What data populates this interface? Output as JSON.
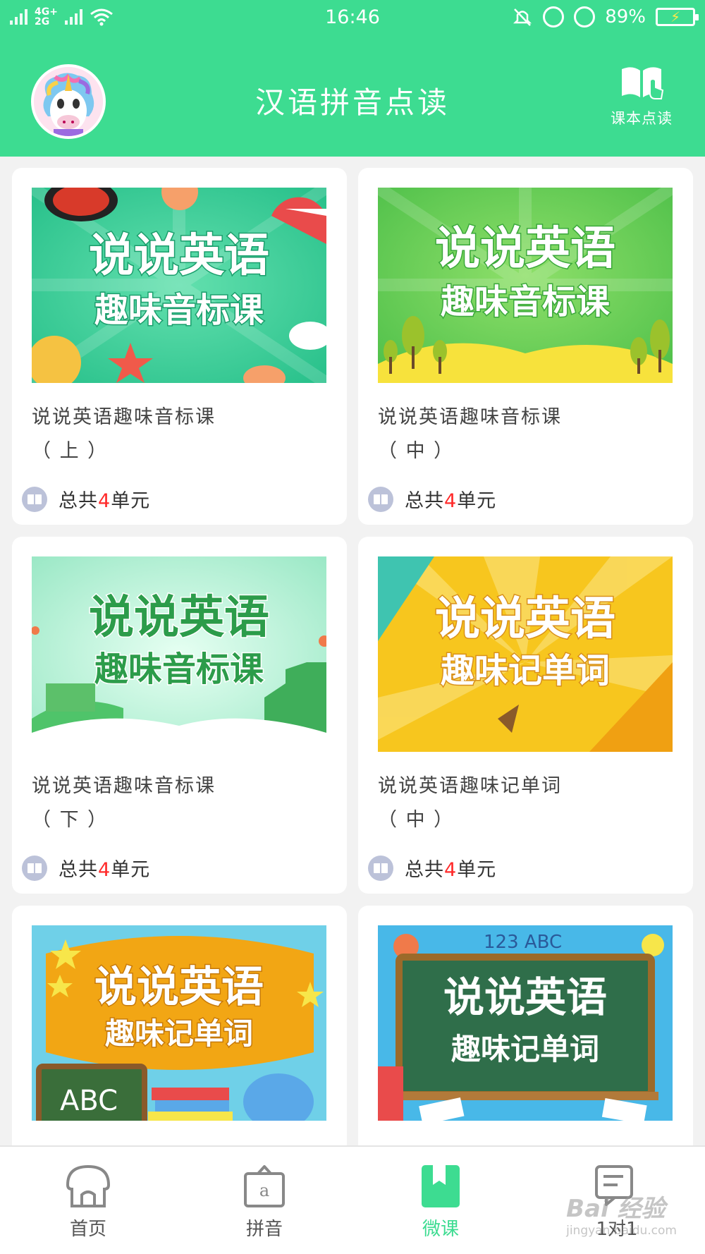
{
  "status_bar": {
    "network": "4G+\n2G",
    "time": "16:46",
    "battery": "89%"
  },
  "header": {
    "title": "汉语拼音点读",
    "textbook_button": "课本点读"
  },
  "cards": [
    {
      "title_line1": "说说英语趣味音标课",
      "title_line2": "（ 上 ）",
      "banner_line1": "说说英语",
      "banner_line2": "趣味音标课",
      "total_prefix": "总共",
      "total_units": "4",
      "total_suffix": "单元"
    },
    {
      "title_line1": "说说英语趣味音标课",
      "title_line2": "（ 中 ）",
      "banner_line1": "说说英语",
      "banner_line2": "趣味音标课",
      "total_prefix": "总共",
      "total_units": "4",
      "total_suffix": "单元"
    },
    {
      "title_line1": "说说英语趣味音标课",
      "title_line2": "（ 下 ）",
      "banner_line1": "说说英语",
      "banner_line2": "趣味音标课",
      "total_prefix": "总共",
      "total_units": "4",
      "total_suffix": "单元"
    },
    {
      "title_line1": "说说英语趣味记单词",
      "title_line2": "（ 中 ）",
      "banner_line1": "说说英语",
      "banner_line2": "趣味记单词",
      "total_prefix": "总共",
      "total_units": "4",
      "total_suffix": "单元"
    },
    {
      "banner_line1": "说说英语",
      "banner_line2": "趣味记单词",
      "chalk_letters": "ABC"
    },
    {
      "banner_line1": "说说英语",
      "banner_line2": "趣味记单词",
      "chalk_letters": "123 ABC"
    }
  ],
  "tabs": [
    {
      "label": "首页",
      "icon": "home-icon",
      "active": false
    },
    {
      "label": "拼音",
      "icon": "pinyin-icon",
      "glyph": "a",
      "active": false
    },
    {
      "label": "微课",
      "icon": "bookmark-icon",
      "active": true
    },
    {
      "label": "1对1",
      "icon": "chat-icon",
      "active": false
    }
  ],
  "watermark": {
    "brand": "Bai 经验",
    "url": "jingyan.baidu.com"
  },
  "colors": {
    "accent": "#3ddc91",
    "highlight_number": "#ff2a2a",
    "icon_grey": "#bcc2d9"
  }
}
